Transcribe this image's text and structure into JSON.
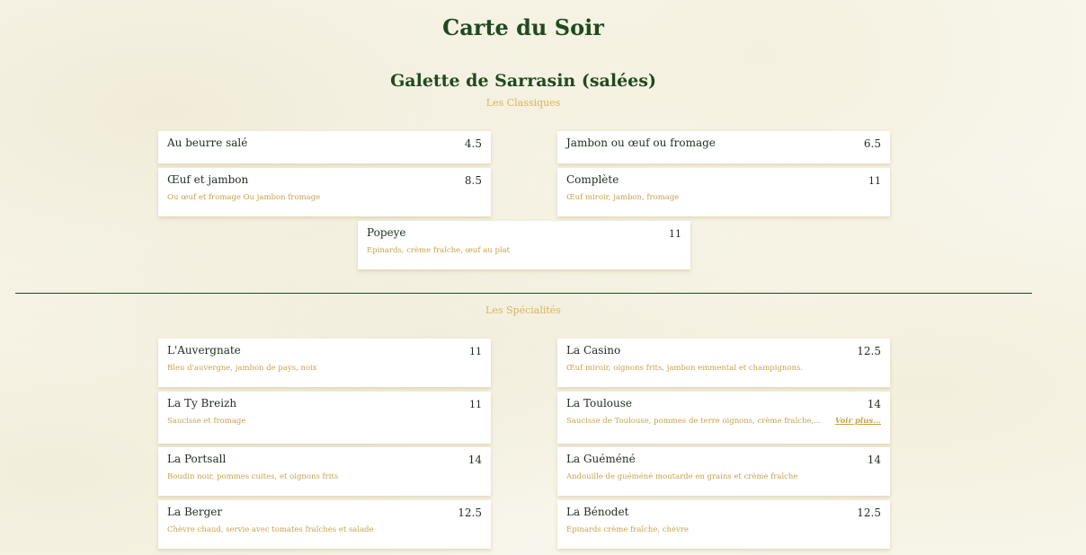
{
  "page": {
    "title": "Carte du Soir"
  },
  "section": {
    "title": "Galette de Sarrasin (salées)",
    "classiques_label": "Les Classiques",
    "specialites_label": "Les Spécialités"
  },
  "classiques": [
    {
      "name": "Au beurre salé",
      "price": "4.5",
      "desc": ""
    },
    {
      "name": "Jambon ou œuf ou fromage",
      "price": "6.5",
      "desc": ""
    },
    {
      "name": "Œuf et jambon",
      "price": "8.5",
      "desc": "Ou œuf et fromage Ou jambon fromage"
    },
    {
      "name": "Complète",
      "price": "11",
      "desc": "Œuf miroir, jambon, fromage"
    },
    {
      "name": "Popeye",
      "price": "11",
      "desc": "Epinards, crème fraîche, œuf au plat"
    }
  ],
  "specialites": [
    {
      "name": "L'Auvergnate",
      "price": "11",
      "desc": "Bleu d'auvergne, jambon de pays, noix"
    },
    {
      "name": "La Casino",
      "price": "12.5",
      "desc": "Œuf miroir, oignons frits, jambon emmental et champignons."
    },
    {
      "name": "La Ty Breizh",
      "price": "11",
      "desc": "Saucisse et fromage"
    },
    {
      "name": "La Toulouse",
      "price": "14",
      "desc": "Saucisse de Toulouse, pommes de terre oignons, crème fraîche,...",
      "more": "Voir plus..."
    },
    {
      "name": "La Portsall",
      "price": "14",
      "desc": "Boudin noir, pommes cuites, et oignons frits"
    },
    {
      "name": "La Guéméné",
      "price": "14",
      "desc": "Andouille de guéméné moutarde en grains et crème fraîche"
    },
    {
      "name": "La Berger",
      "price": "12.5",
      "desc": "Chèvre chaud, servie avec tomates fraîches et salade"
    },
    {
      "name": "La Bénodet",
      "price": "12.5",
      "desc": "Épinards crème fraîche, chèvre"
    }
  ]
}
